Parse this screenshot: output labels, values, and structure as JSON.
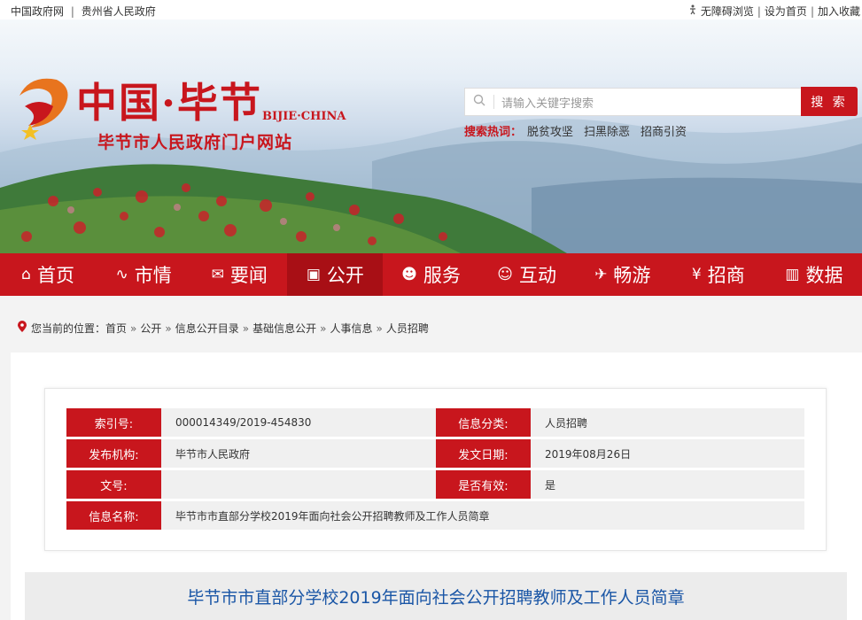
{
  "topbar": {
    "links_left": [
      "中国政府网",
      "贵州省人民政府"
    ],
    "links_right": [
      "无障碍浏览",
      "设为首页",
      "加入收藏"
    ],
    "separator": "|"
  },
  "header": {
    "logo_text": "中国·毕节",
    "logo_en": "BIJIE·CHINA",
    "site_name": "毕节市人民政府门户网站",
    "search": {
      "placeholder": "请输入关键字搜索",
      "button": "搜 索"
    },
    "hot": {
      "label": "搜索热词：",
      "words": [
        "脱贫攻坚",
        "扫黑除恶",
        "招商引资"
      ]
    }
  },
  "nav": [
    {
      "label": "首页",
      "icon": "home-icon",
      "glyph": "⌂"
    },
    {
      "label": "市情",
      "icon": "pulse-icon",
      "glyph": "∿"
    },
    {
      "label": "要闻",
      "icon": "news-icon",
      "glyph": "✉"
    },
    {
      "label": "公开",
      "icon": "monitor-icon",
      "glyph": "▣"
    },
    {
      "label": "服务",
      "icon": "person-icon",
      "glyph": "☻"
    },
    {
      "label": "互动",
      "icon": "chat-icon",
      "glyph": "☺"
    },
    {
      "label": "畅游",
      "icon": "plane-icon",
      "glyph": "✈"
    },
    {
      "label": "招商",
      "icon": "money-icon",
      "glyph": "¥"
    },
    {
      "label": "数据",
      "icon": "bar-chart-icon",
      "glyph": "▥"
    }
  ],
  "active_nav": "公开",
  "breadcrumb": {
    "prefix": "您当前的位置：",
    "items": [
      "首页",
      "公开",
      "信息公开目录",
      "基础信息公开",
      "人事信息",
      "人员招聘"
    ],
    "arrow": "»"
  },
  "info_table": {
    "index_label": "索引号:",
    "index_value": "000014349/2019-454830",
    "category_label": "信息分类:",
    "category_value": "人员招聘",
    "publisher_label": "发布机构:",
    "publisher_value": "毕节市人民政府",
    "date_label": "发文日期:",
    "date_value": "2019年08月26日",
    "docno_label": "文号:",
    "docno_value": "",
    "valid_label": "是否有效:",
    "valid_value": "是",
    "name_label": "信息名称:",
    "name_value": "毕节市市直部分学校2019年面向社会公开招聘教师及工作人员简章"
  },
  "article_title": "毕节市市直部分学校2019年面向社会公开招聘教师及工作人员简章",
  "colors": {
    "brand_red": "#c8161d",
    "title_blue": "#1a56a6"
  }
}
